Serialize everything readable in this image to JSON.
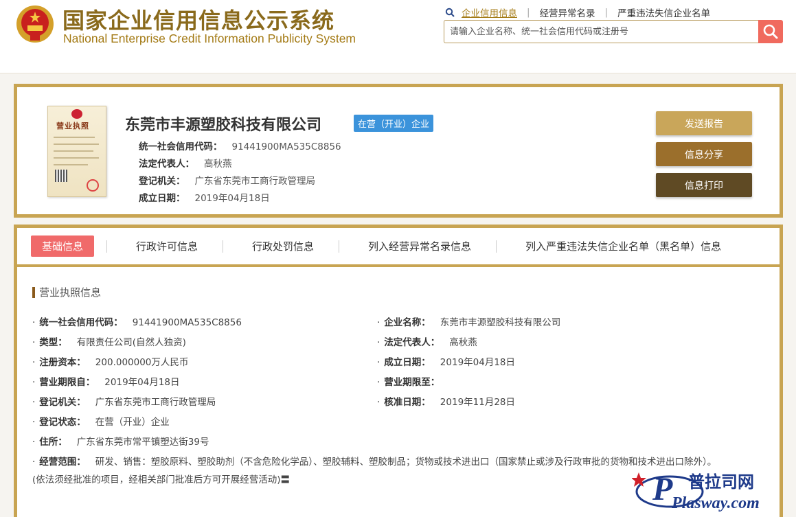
{
  "header": {
    "title_cn": "国家企业信用信息公示系统",
    "title_en": "National Enterprise Credit Information Publicity System",
    "nav": [
      "企业信用信息",
      "经营异常名录",
      "严重违法失信企业名单"
    ],
    "search_placeholder": "请输入企业名称、统一社会信用代码或注册号",
    "colors": {
      "brand_gold": "#a47b16",
      "search_button": "#f06a5e"
    }
  },
  "card": {
    "company_name": "东莞市丰源塑胶科技有限公司",
    "status_badge": "在营（开业）企业",
    "license_title": "营业执照",
    "rows": [
      {
        "label": "统一社会信用代码：",
        "value": "91441900MA535C8856"
      },
      {
        "label": "法定代表人：",
        "value": "高秋燕"
      },
      {
        "label": "登记机关：",
        "value": "广东省东莞市工商行政管理局"
      },
      {
        "label": "成立日期：",
        "value": "2019年04月18日"
      }
    ],
    "buttons": [
      "发送报告",
      "信息分享",
      "信息打印"
    ]
  },
  "detail": {
    "tabs": [
      "基础信息",
      "行政许可信息",
      "行政处罚信息",
      "列入经营异常名录信息",
      "列入严重违法失信企业名单（黑名单）信息"
    ],
    "section_title": "营业执照信息",
    "left_fields": [
      {
        "label": "统一社会信用代码：",
        "value": "91441900MA535C8856"
      },
      {
        "label": "类型：",
        "value": "有限责任公司(自然人独资)"
      },
      {
        "label": "注册资本：",
        "value": "200.000000万人民币"
      },
      {
        "label": "营业期限自：",
        "value": "2019年04月18日"
      },
      {
        "label": "登记机关：",
        "value": "广东省东莞市工商行政管理局"
      },
      {
        "label": "登记状态：",
        "value": "在营（开业）企业"
      },
      {
        "label": "住所：",
        "value": "广东省东莞市常平镇塑达街39号"
      }
    ],
    "right_fields": [
      {
        "label": "企业名称：",
        "value": "东莞市丰源塑胶科技有限公司"
      },
      {
        "label": "法定代表人：",
        "value": "高秋燕"
      },
      {
        "label": "成立日期：",
        "value": "2019年04月18日"
      },
      {
        "label": "营业期限至：",
        "value": ""
      },
      {
        "label": "核准日期：",
        "value": "2019年11月28日"
      }
    ],
    "scope": {
      "label": "经营范围：",
      "value": "研发、销售：塑胶原料、塑胶助剂（不含危险化学品）、塑胶辅料、塑胶制品；货物或技术进出口（国家禁止或涉及行政审批的货物和技术进出口除外）。",
      "note": "(依法须经批准的项目，经相关部门批准后方可开展经营活动)〓"
    }
  },
  "watermark": {
    "cn": "普拉司网",
    "en": "Plasway.com"
  }
}
